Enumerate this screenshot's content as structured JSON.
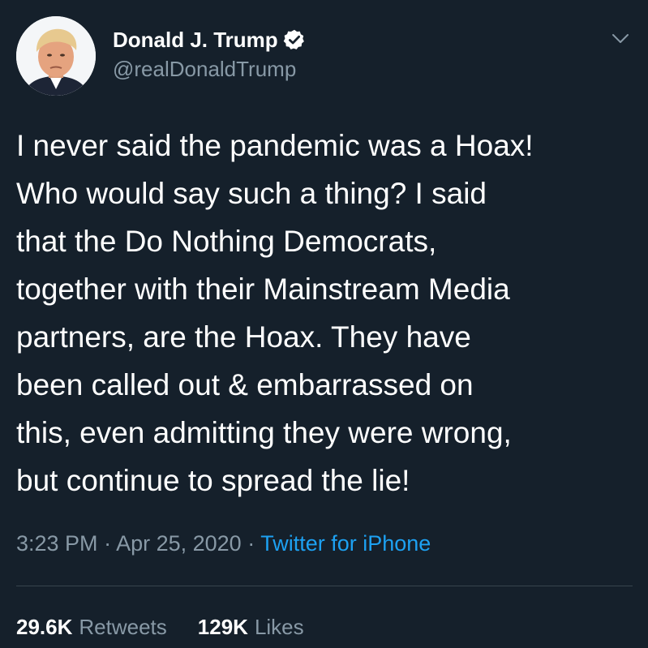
{
  "author": {
    "display_name": "Donald J. Trump",
    "handle": "@realDonaldTrump",
    "verified": true,
    "avatar_icon": "profile-photo"
  },
  "tweet": {
    "lines": [
      "I never said the pandemic was a Hoax!",
      "Who would say such a thing? I said",
      "that the Do Nothing Democrats,",
      "together with their Mainstream Media",
      "partners, are the Hoax. They have",
      "been called out & embarrassed on",
      "this, even admitting they were wrong,",
      "but continue to spread the lie!"
    ]
  },
  "meta": {
    "time": "3:23 PM",
    "separator": " · ",
    "date": "Apr 25, 2020",
    "source": "Twitter for iPhone"
  },
  "stats": {
    "retweets_count": "29.6K",
    "retweets_label": "Retweets",
    "likes_count": "129K",
    "likes_label": "Likes"
  },
  "colors": {
    "background": "#15202b",
    "primary_text": "#ffffff",
    "secondary_text": "#8899a6",
    "link": "#1da1f2",
    "divider": "#38444d"
  }
}
